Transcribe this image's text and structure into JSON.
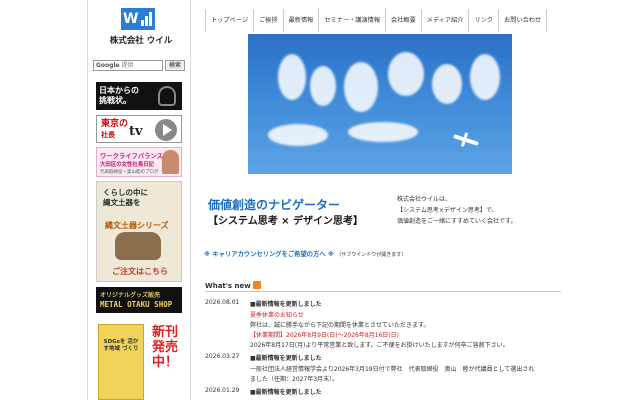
{
  "logo": {
    "company_name": "株式会社 ウイル",
    "mark_letter": "W",
    "brand_color": "#2b7cd3"
  },
  "search": {
    "placeholder_brand": "Google",
    "placeholder_suffix": "提供",
    "button_label": "検索"
  },
  "nav": {
    "items": [
      "トップページ",
      "ご挨拶",
      "最新情報",
      "セミナー・講演情報",
      "会社概要",
      "メディア紹介",
      "リンク",
      "お問い合わせ"
    ]
  },
  "banners": {
    "challenge": {
      "text_line1": "日本からの",
      "text_line2": "挑戦状。"
    },
    "tokyo_tv": {
      "line1": "東京の",
      "line2": "社長",
      "tv": "tv"
    },
    "worklife": {
      "line1": "ワークライフバランス",
      "line2": "大田区の女性社長日記",
      "line3": "代表取締役・奥山睦のブログ"
    },
    "jomon": {
      "line1": "くらしの中に",
      "line2": "縄文土器を",
      "line3": "縄文土器シリーズ",
      "cta": "ご注文はこちら"
    },
    "otaku": {
      "line1": "オリジナルグッズ販売",
      "line2": "METAL OTAKU SHOP"
    },
    "book": {
      "title": "SDGsを 活かす地域 づくり",
      "badge": "新刊発売中！"
    }
  },
  "tagline": {
    "title": "価値創造のナビゲーター",
    "subtitle": "【システム思考 × デザイン思考】",
    "description_lines": [
      "株式会社ウイルは、",
      "【システム思考×デザイン思考】で、",
      "価値創造をご一緒にすすめていく会社です。"
    ]
  },
  "career_link": {
    "label": "※ キャリアカウンセリングをご希望の方へ ※",
    "note": "（サブウインドウが開きます）"
  },
  "whats_new": {
    "heading": "What's new"
  },
  "news": [
    {
      "date": "2026.08.01",
      "headline": "■最新情報を更新しました",
      "lines": [
        {
          "text": "夏季休業のお知らせ",
          "accent": true
        },
        {
          "text": "弊社は、誠に勝手ながら下記の期間を休業とさせていただきます。",
          "accent": false
        },
        {
          "text": "【休業期間】2026年8月9日(日)〜2026年8月16日(日)",
          "accent": true
        },
        {
          "text": "2026年8月17日(月)より平常営業と致します。ご不便をお掛けいたしますが何卒ご容赦下さい。",
          "accent": false
        }
      ]
    },
    {
      "date": "2026.03.27",
      "headline": "■最新情報を更新しました",
      "lines": [
        {
          "text": "一般社団法人経営情報学会より2026年3月19日付で弊社　代表取締役　奥山　睦が代議員として選出され",
          "accent": false
        },
        {
          "text": "ました（任期：2027年3月末）。",
          "accent": false
        }
      ]
    },
    {
      "date": "2026.01.29",
      "headline": "■最新情報を更新しました",
      "lines": []
    }
  ]
}
